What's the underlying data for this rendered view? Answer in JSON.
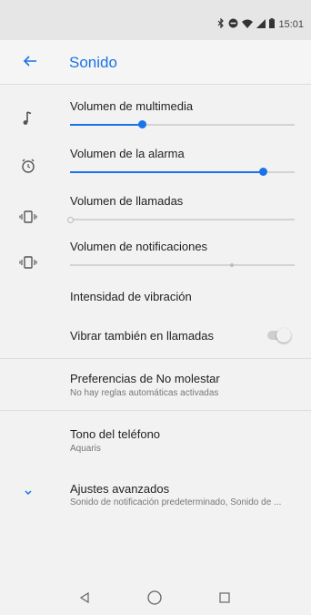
{
  "status_bar": {
    "time": "15:01",
    "icons": [
      "bluetooth-icon",
      "do-not-disturb-icon",
      "wifi-icon",
      "signal-icon",
      "battery-icon"
    ]
  },
  "app_bar": {
    "title": "Sonido",
    "accent_color": "#1a73e8"
  },
  "volumes": [
    {
      "label": "Volumen de multimedia",
      "icon": "music-note-icon",
      "level": 0.32
    },
    {
      "label": "Volumen de la alarma",
      "icon": "alarm-icon",
      "level": 0.86
    },
    {
      "label": "Volumen de llamadas",
      "icon": "vibrate-icon",
      "level": 0.0
    },
    {
      "label": "Volumen de notificaciones",
      "icon": "vibrate-icon",
      "level": 0.0
    }
  ],
  "settings": {
    "vibration_intensity": "Intensidad de vibración",
    "vibrate_calls": {
      "label": "Vibrar también en llamadas",
      "enabled": false
    },
    "dnd": {
      "label": "Preferencias de No molestar",
      "sub": "No hay reglas automáticas activadas"
    },
    "ringtone": {
      "label": "Tono del teléfono",
      "sub": "Aquaris"
    },
    "advanced": {
      "label": "Ajustes avanzados",
      "sub": "Sonido de notificación predeterminado, Sonido de ..."
    }
  },
  "nav_bar": {
    "back": "back-nav-icon",
    "home": "home-nav-icon",
    "recents": "recents-nav-icon"
  }
}
